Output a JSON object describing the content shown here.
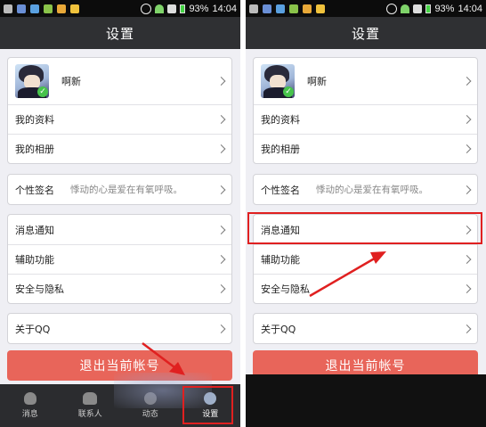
{
  "status_bar": {
    "battery": "93%",
    "time": "14:04"
  },
  "title": "设置",
  "profile": {
    "name": "啊新"
  },
  "menu": {
    "my_info": "我的资料",
    "my_album": "我的相册",
    "signature_label": "个性签名",
    "signature_value": "悸动的心是爱在有氧呼吸。",
    "notifications": "消息通知",
    "accessibility": "辅助功能",
    "privacy": "安全与隐私",
    "about": "关于QQ"
  },
  "logout_label": "退出当前帐号",
  "tabs": {
    "messages": "消息",
    "contacts": "联系人",
    "feed": "动态",
    "settings": "设置"
  },
  "colors": {
    "accent_red": "#e02020",
    "logout": "#e8655a",
    "titlebar": "#2f3033"
  }
}
